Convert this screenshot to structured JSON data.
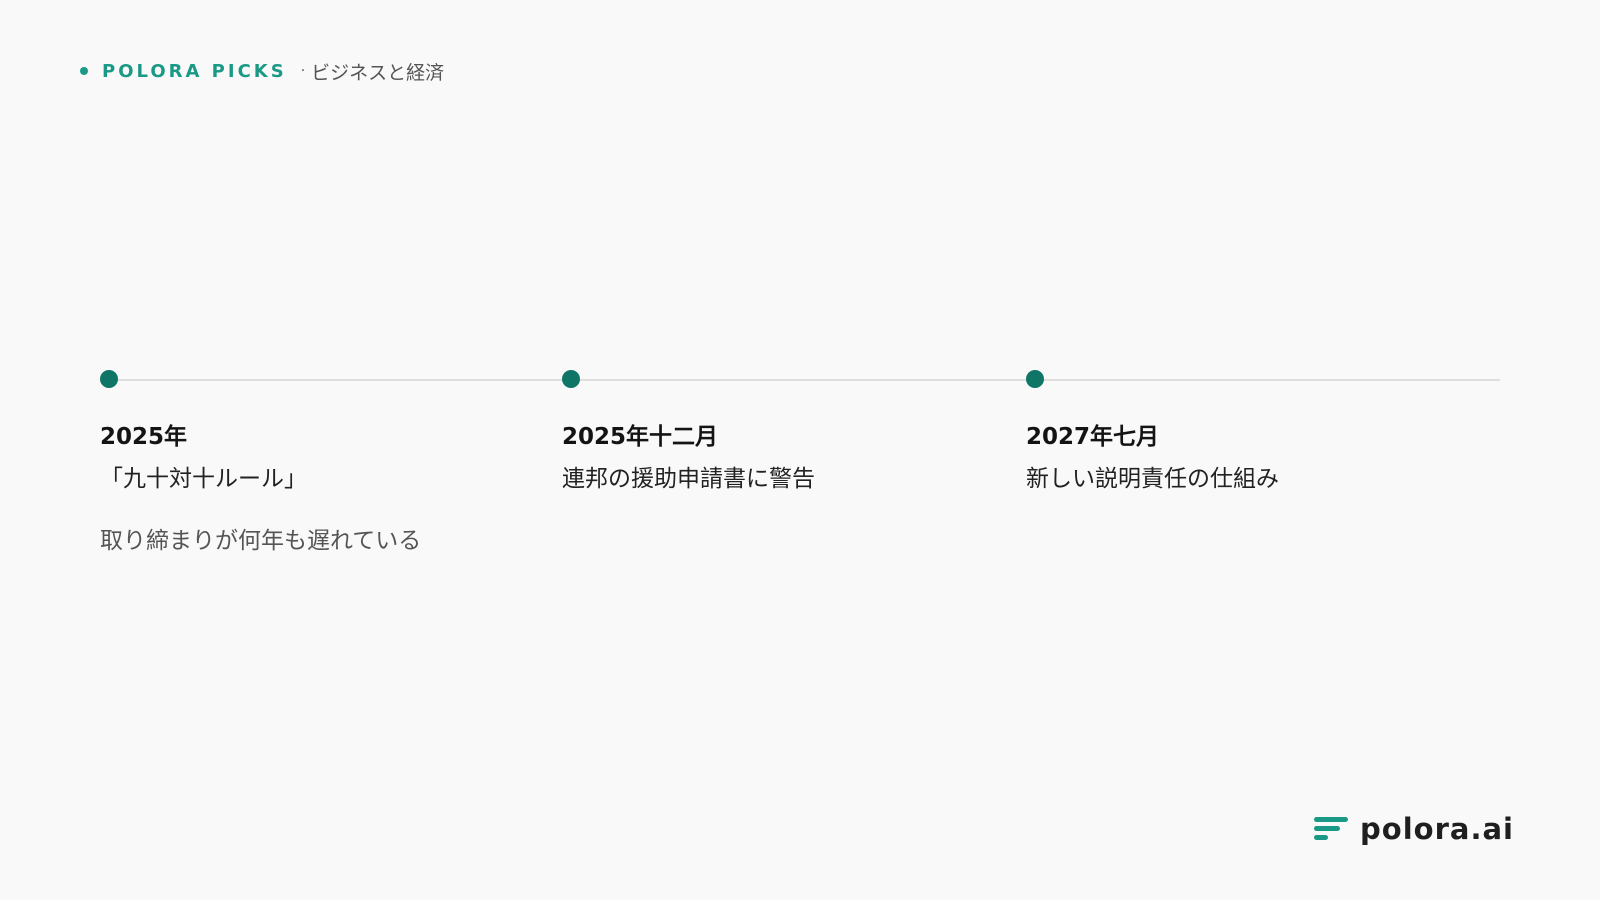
{
  "header": {
    "brand": "POLORA PICKS",
    "separator": "·",
    "category": "ビジネスと経済"
  },
  "timeline": {
    "milestones": [
      {
        "date": "2025年",
        "title": "「九十対十ルール」",
        "description": "取り締まりが何年も遅れている"
      },
      {
        "date": "2025年十二月",
        "title": "連邦の援助申請書に警告",
        "description": ""
      },
      {
        "date": "2027年七月",
        "title": "新しい説明責任の仕組み",
        "description": ""
      }
    ]
  },
  "footer": {
    "logo_text": "polora.ai"
  },
  "colors": {
    "accent": "#1a9a86",
    "milestone_dot": "#0f7567",
    "background": "#f9f9f9",
    "line": "#dedede"
  }
}
